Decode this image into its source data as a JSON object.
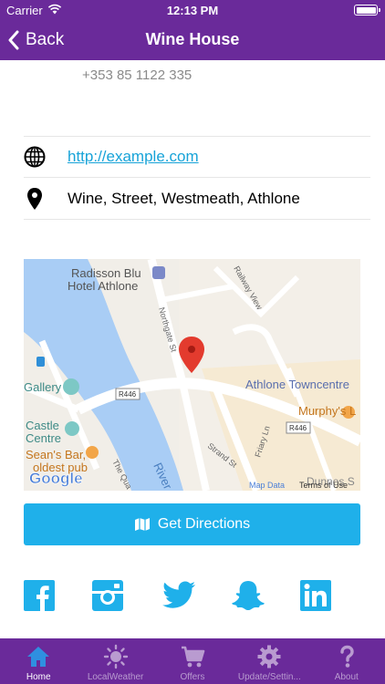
{
  "status": {
    "carrier": "Carrier",
    "time": "12:13 PM"
  },
  "nav": {
    "back_label": "Back",
    "title": "Wine House"
  },
  "contact": {
    "phone": "+353 85 1122 335",
    "website": "http://example.com",
    "address": "Wine, Street, Westmeath, Athlone"
  },
  "map": {
    "labels": {
      "hotel_line1": "Radisson Blu",
      "hotel_line2": "Hotel Athlone",
      "railway": "Railway View",
      "northgate": "Northgate St",
      "gallery": "Gallery",
      "r446_a": "R446",
      "r446_b": "R446",
      "towncentre": "Athlone Towncentre",
      "murphys": "Murphy's L",
      "castle_line1": "Castle",
      "castle_line2": "Centre",
      "seans_line1": "Sean's Bar,",
      "seans_line2": "oldest pub",
      "quay": "The Qua",
      "river": "River",
      "strand": "Strand St",
      "friary": "Friary Ln",
      "dunnes": "Dunnes S",
      "attribution": "Map Data",
      "terms": "Terms of Use",
      "logo": "Google"
    }
  },
  "directions": {
    "label": "Get Directions"
  },
  "colors": {
    "brand_purple": "#6a2a9a",
    "accent_blue": "#1fb0ea",
    "link_blue": "#17a3d8",
    "pin_red": "#e33b2e"
  },
  "social": [
    "facebook-icon",
    "instagram-icon",
    "twitter-icon",
    "snapchat-icon",
    "linkedin-icon"
  ],
  "tabs": [
    {
      "label": "Home",
      "icon": "home-icon",
      "active": true
    },
    {
      "label": "LocalWeather",
      "icon": "sun-icon",
      "active": false
    },
    {
      "label": "Offers",
      "icon": "cart-icon",
      "active": false
    },
    {
      "label": "Update/Settin...",
      "icon": "gear-icon",
      "active": false
    },
    {
      "label": "About",
      "icon": "question-icon",
      "active": false
    }
  ]
}
